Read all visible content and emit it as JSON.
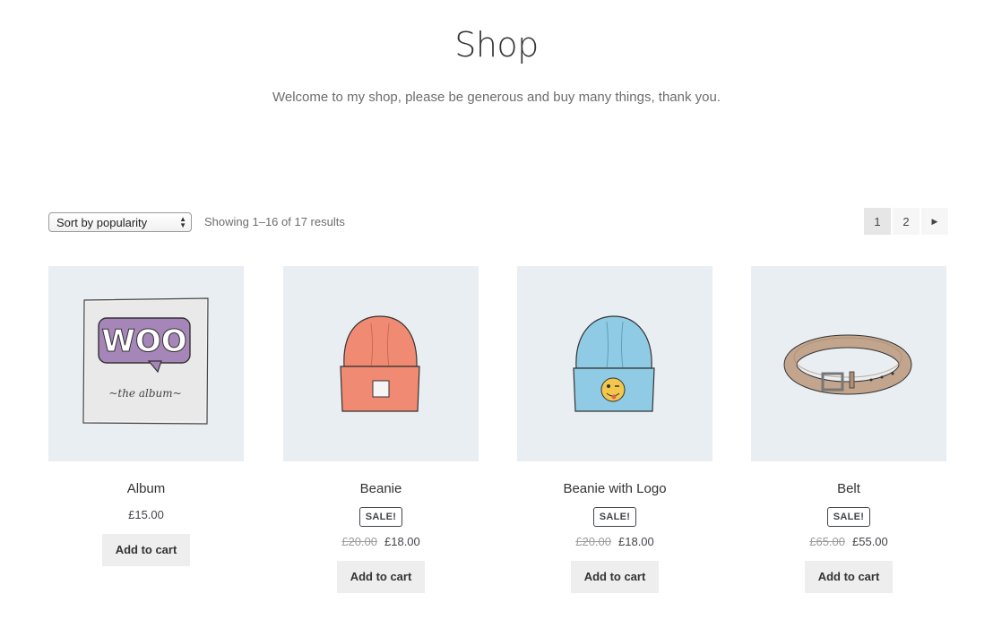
{
  "page": {
    "title": "Shop",
    "description": "Welcome to my shop, please be generous and buy many things, thank you."
  },
  "toolbar": {
    "sort_selected": "Sort by popularity",
    "result_count": "Showing 1–16 of 17 results"
  },
  "pagination": {
    "pages": [
      "1",
      "2"
    ],
    "current": "1",
    "next_icon": "triangle-right-icon"
  },
  "products": [
    {
      "title": "Album",
      "price": "£15.00",
      "old_price": "",
      "sale_badge": "",
      "button": "Add to cart",
      "image": "album-image"
    },
    {
      "title": "Beanie",
      "price": "£18.00",
      "old_price": "£20.00",
      "sale_badge": "SALE!",
      "button": "Add to cart",
      "image": "beanie-image"
    },
    {
      "title": "Beanie with Logo",
      "price": "£18.00",
      "old_price": "£20.00",
      "sale_badge": "SALE!",
      "button": "Add to cart",
      "image": "beanie-with-logo-image"
    },
    {
      "title": "Belt",
      "price": "£55.00",
      "old_price": "£65.00",
      "sale_badge": "SALE!",
      "button": "Add to cart",
      "image": "belt-image"
    }
  ],
  "image_text": {
    "woo_logo": "WOO",
    "album_caption": "~the   album~"
  },
  "colors": {
    "image_background": "#e9eef2",
    "button_background": "#eeeeee",
    "beanie": "#f08a72",
    "beanie_with_logo": "#8fcbe4",
    "belt": "#c2a58c",
    "woo_purple": "#a685b8"
  }
}
